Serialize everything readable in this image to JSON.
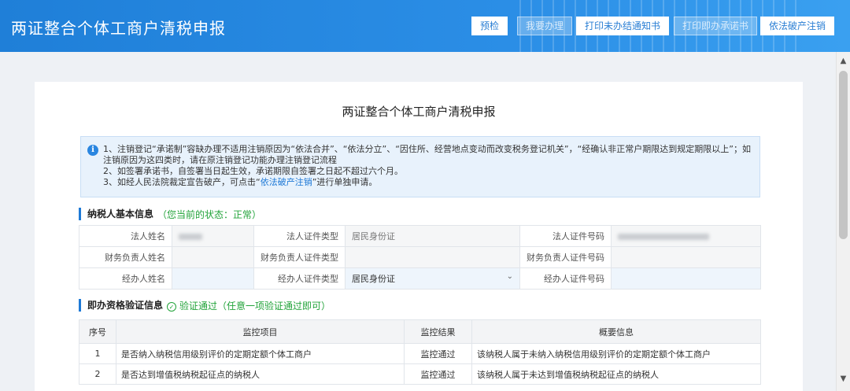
{
  "header": {
    "title": "两证整合个体工商户清税申报",
    "buttons": [
      {
        "label": "预检",
        "enabled": true
      },
      {
        "label": "我要办理",
        "enabled": false
      },
      {
        "label": "打印未办结通知书",
        "enabled": true
      },
      {
        "label": "打印即办承诺书",
        "enabled": false
      },
      {
        "label": "依法破产注销",
        "enabled": true
      }
    ]
  },
  "panel": {
    "title": "两证整合个体工商户清税申报"
  },
  "notice": {
    "line1": "1、注销登记“承诺制”容缺办理不适用注销原因为“依法合并”、“依法分立”、“因住所、经营地点变动而改变税务登记机关”，“经确认非正常户期限达到规定期限以上”；如注销原因为这四类时，请在原注销登记功能办理注销登记流程",
    "line2": "2、如签署承诺书，自签署当日起生效，承诺期限自签署之日起不超过六个月。",
    "line3_pre": "3、如经人民法院裁定宣告破产，可点击“",
    "line3_link": "依法破产注销",
    "line3_post": "”进行单独申请。"
  },
  "taxpayer": {
    "section_title": "纳税人基本信息",
    "status_text": "（您当前的状态：正常）",
    "rows": [
      {
        "l1": "法人姓名",
        "v1": "",
        "l2": "法人证件类型",
        "v2": "居民身份证",
        "l3": "法人证件号码",
        "v3": ""
      },
      {
        "l1": "财务负责人姓名",
        "v1": "",
        "l2": "财务负责人证件类型",
        "v2": "",
        "l3": "财务负责人证件号码",
        "v3": ""
      },
      {
        "l1": "经办人姓名",
        "v1": "",
        "l2": "经办人证件类型",
        "v2": "居民身份证",
        "l3": "经办人证件号码",
        "v3": ""
      }
    ]
  },
  "verification": {
    "section_title": "即办资格验证信息",
    "status_text": "验证通过（任意一项验证通过即可）",
    "columns": [
      "序号",
      "监控项目",
      "监控结果",
      "概要信息"
    ],
    "rows": [
      {
        "no": "1",
        "item": "是否纳入纳税信用级别评价的定期定额个体工商户",
        "result": "监控通过",
        "summary": "该纳税人属于未纳入纳税信用级别评价的定期定额个体工商户"
      },
      {
        "no": "2",
        "item": "是否达到增值税纳税起征点的纳税人",
        "result": "监控通过",
        "summary": "该纳税人属于未达到增值税纳税起征点的纳税人"
      }
    ]
  },
  "icons": {
    "info": "info-icon",
    "check": "check-circle-icon",
    "chevron": "chevron-down-icon"
  },
  "colors": {
    "header": "#2b8ee6",
    "accent": "#1e7ad6",
    "success": "#22a33a"
  }
}
